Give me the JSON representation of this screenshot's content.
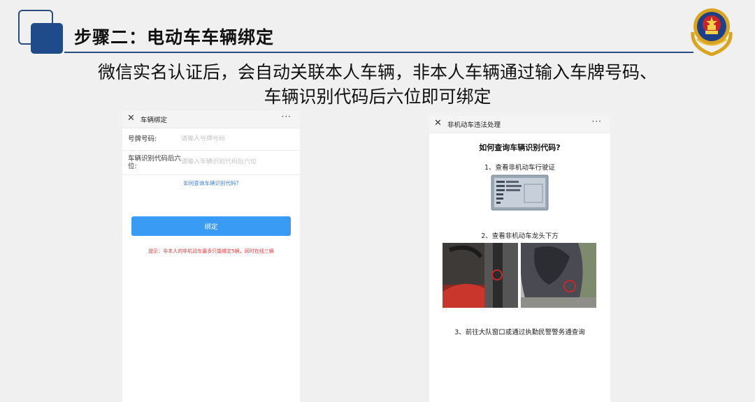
{
  "slide": {
    "title": "步骤二：电动车车辆绑定",
    "subtitle_lines": [
      "微信实名认证后，会自动关联本人车辆，非本人车辆通过输入车牌号码、",
      "车辆识别代码后六位即可绑定"
    ]
  },
  "binding_screen": {
    "header_title": "车辆绑定",
    "close_glyph": "✕",
    "more_glyph": "···",
    "plate_label": "号牌号码:",
    "plate_placeholder": "请输入号牌号码",
    "vin_label": "车辆识别代码后六位:",
    "vin_placeholder": "请输入车辆识别代码后六位",
    "help_link": "如何查询车辆识别代码?",
    "bind_button": "绑定",
    "tip": "提示：非本人的非机动车最多只能绑定5辆，同时在线三辆"
  },
  "help_screen": {
    "header_title": "非机动车违法处理",
    "close_glyph": "✕",
    "more_glyph": "···",
    "question": "如何查询车辆识别代码?",
    "step1": "1、查看非机动车行驶证",
    "step2": "2、查看非机动车龙头下方",
    "step3": "3、前往大队窗口或通过执勤民警警务通查询"
  },
  "colors": {
    "accent_blue": "#1f4b8a",
    "button_blue": "#3a9bf5",
    "link_blue": "#3a7fd5",
    "tip_red": "#e23a3a"
  },
  "icons": [
    "close-icon",
    "more-icon",
    "police-emblem-icon"
  ]
}
